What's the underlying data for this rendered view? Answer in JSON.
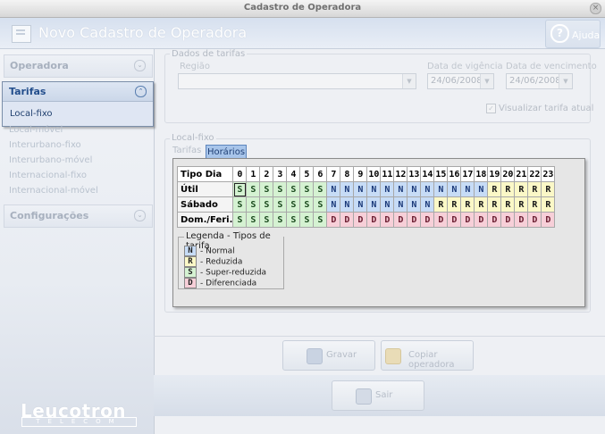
{
  "window": {
    "title": "Cadastro de Operadora",
    "close_glyph": "×"
  },
  "header": {
    "title": "Novo Cadastro de Operadora",
    "help_label": "Ajuda",
    "help_glyph": "?"
  },
  "sidebar": {
    "sections": {
      "operadora": "Operadora",
      "tarifas": "Tarifas",
      "configuracoes": "Configurações"
    },
    "selected_item": "Local-fixo",
    "items": [
      "Local-móvel",
      "Interurbano-fixo",
      "Interurbano-móvel",
      "Internacional-fixo",
      "Internacional-móvel"
    ],
    "brand": "Leucotron",
    "brand_sub": "TELECOM"
  },
  "dados": {
    "group_label": "Dados de tarifas",
    "regiao_label": "Região",
    "regiao_value": "",
    "vigencia_label": "Data de vigência",
    "vigencia_value": "24/06/2008",
    "vencimento_label": "Data de vencimento",
    "vencimento_value": "24/06/2008",
    "visualizar_label": "Visualizar tarifa atual",
    "visualizar_checked": true
  },
  "local": {
    "group_label": "Local-fixo",
    "tabs": [
      "Tarifas",
      "Horários"
    ],
    "active_tab": "Horários"
  },
  "schedule": {
    "header_label": "Tipo Dia",
    "hours": [
      "0",
      "1",
      "2",
      "3",
      "4",
      "5",
      "6",
      "7",
      "8",
      "9",
      "10",
      "11",
      "12",
      "13",
      "14",
      "15",
      "16",
      "17",
      "18",
      "19",
      "20",
      "21",
      "22",
      "23"
    ],
    "rows": [
      {
        "label": "Útil",
        "codes": [
          "S",
          "S",
          "S",
          "S",
          "S",
          "S",
          "S",
          "N",
          "N",
          "N",
          "N",
          "N",
          "N",
          "N",
          "N",
          "N",
          "N",
          "N",
          "N",
          "R",
          "R",
          "R",
          "R",
          "R"
        ]
      },
      {
        "label": "Sábado",
        "codes": [
          "S",
          "S",
          "S",
          "S",
          "S",
          "S",
          "S",
          "N",
          "N",
          "N",
          "N",
          "N",
          "N",
          "N",
          "N",
          "R",
          "R",
          "R",
          "R",
          "R",
          "R",
          "R",
          "R",
          "R"
        ]
      },
      {
        "label": "Dom./Feri.",
        "codes": [
          "S",
          "S",
          "S",
          "S",
          "S",
          "S",
          "S",
          "D",
          "D",
          "D",
          "D",
          "D",
          "D",
          "D",
          "D",
          "D",
          "D",
          "D",
          "D",
          "D",
          "D",
          "D",
          "D",
          "D"
        ]
      }
    ],
    "selected_cell": {
      "row": 0,
      "hour": 0
    },
    "colors": {
      "N": "#c7dcf6",
      "R": "#fbf8c7",
      "S": "#d5f2d2",
      "D": "#f7cfd8"
    }
  },
  "legend": {
    "title": "Legenda - Tipos de tarifa",
    "entries": [
      {
        "code": "N",
        "label": "- Normal"
      },
      {
        "code": "R",
        "label": "- Reduzida"
      },
      {
        "code": "S",
        "label": "- Super-reduzida"
      },
      {
        "code": "D",
        "label": "- Diferenciada"
      }
    ]
  },
  "buttons": {
    "gravar": "Gravar",
    "copiar": "Copiar operadora",
    "sair": "Sair"
  }
}
